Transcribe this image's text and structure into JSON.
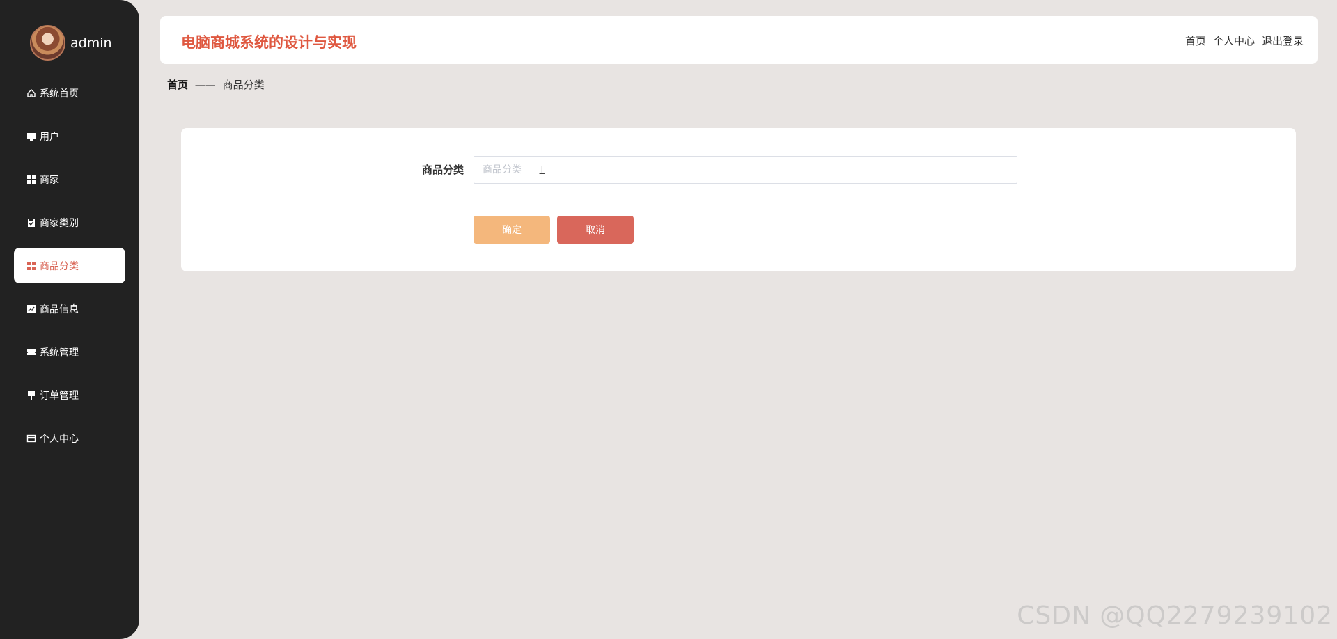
{
  "sidebar": {
    "user": {
      "name": "admin"
    },
    "items": [
      {
        "label": "系统首页",
        "icon": "home-icon",
        "active": false
      },
      {
        "label": "用户",
        "icon": "monitor-icon",
        "active": false
      },
      {
        "label": "商家",
        "icon": "grid-icon",
        "active": false
      },
      {
        "label": "商家类别",
        "icon": "clipboard-icon",
        "active": false
      },
      {
        "label": "商品分类",
        "icon": "grid-icon",
        "active": true
      },
      {
        "label": "商品信息",
        "icon": "chart-icon",
        "active": false
      },
      {
        "label": "系统管理",
        "icon": "ticket-icon",
        "active": false
      },
      {
        "label": "订单管理",
        "icon": "pin-icon",
        "active": false
      },
      {
        "label": "个人中心",
        "icon": "wallet-icon",
        "active": false
      }
    ]
  },
  "header": {
    "title": "电脑商城系统的设计与实现",
    "links": {
      "home": "首页",
      "profile": "个人中心",
      "logout": "退出登录"
    }
  },
  "breadcrumb": {
    "home": "首页",
    "separator": "——",
    "current": "商品分类"
  },
  "form": {
    "category_label": "商品分类",
    "category_value": "",
    "category_placeholder": "商品分类",
    "confirm_label": "确定",
    "cancel_label": "取消"
  },
  "watermark": "CSDN @QQ2279239102",
  "colors": {
    "sidebar_bg": "#222222",
    "accent": "#df5840",
    "active_text": "#d96455",
    "confirm_button": "#f4b77c",
    "cancel_button": "#d9675b",
    "page_bg": "#e8e4e2"
  }
}
